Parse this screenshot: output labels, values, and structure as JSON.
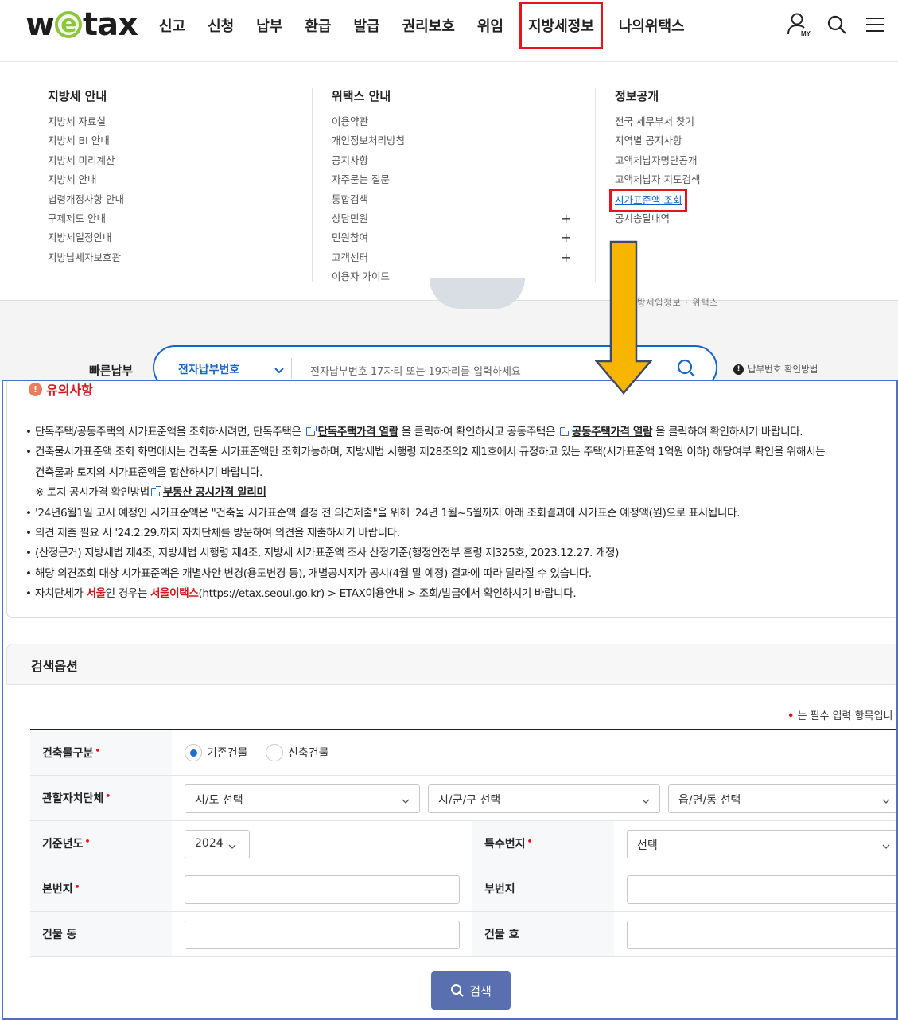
{
  "header": {
    "logo": {
      "pre": "w",
      "mid": "e",
      "post": "tax"
    },
    "nav": [
      "신고",
      "신청",
      "납부",
      "환급",
      "발급",
      "권리보호",
      "위임",
      "지방세정보",
      "나의위택스"
    ],
    "active_nav": "지방세정보",
    "icons": [
      "my-user-icon",
      "search-icon",
      "menu-icon"
    ],
    "my_badge": "MY"
  },
  "mega_menu": {
    "columns": [
      {
        "title": "지방세 안내",
        "items": [
          "지방세 자료실",
          "지방세 BI 안내",
          "지방세 미리계산",
          "지방세 안내",
          "법령개정사항 안내",
          "구제제도 안내",
          "지방세일정안내",
          "지방납세자보호관"
        ]
      },
      {
        "title": "위택스 안내",
        "items": [
          "이용약관",
          "개인정보처리방침",
          "공지사항",
          "자주묻는 질문",
          "통합검색",
          "상담민원",
          "민원참여",
          "고객센터",
          "이용자 가이드"
        ],
        "expandable": [
          5,
          6,
          7
        ],
        "plus": "+"
      },
      {
        "title": "정보공개",
        "items": [
          "전국 세무부서 찾기",
          "지역별 공지사항",
          "고액체납자명단공개",
          "고액체납자 지도검색",
          "시가표준액 조회",
          "공시송달내역"
        ],
        "highlighted": 4
      }
    ]
  },
  "quick_pay": {
    "label": "빠른납부",
    "select_value": "전자납부번호",
    "placeholder": "전자납부번호 17자리 또는 19자리를 입력하세요",
    "help_text": "납부번호 확인방법",
    "help_mark": "!"
  },
  "hero_fragment_text": "지방세입정보 · 위택스",
  "notice": {
    "title": "유의사항",
    "title_mark": "!",
    "items": [
      {
        "a": "단독주택/공동주택의 시가표준액을 조회하시려면, 단독주택은 ",
        "link1": "단독주택가격 열람",
        "b": " 을 클릭하여 확인하시고 공동주택은 ",
        "link2": "공동주택가격 열람",
        "c": " 을 클릭하여 확인하시기 바랍니다."
      },
      {
        "text": "건축물시가표준액 조회 화면에서는 건축물 시가표준액만 조회가능하며, 지방세법 시행령 제28조의2 제1호에서 규정하고 있는 주택(시가표준액 1억원 이하) 해당여부 확인을 위해서는"
      },
      {
        "text": "건축물과 토지의 시가표준액을 합산하시기 바랍니다."
      },
      {
        "prefix": "※  토지 공시가격 확인방법",
        "link": "부동산 공시가격 알리미"
      },
      {
        "text": "'24년6월1일 고시 예정인 시가표준액은 \"건축물 시가표준액 결정 전 의견제출\"을 위해 '24년 1월~5월까지 아래 조회결과에 시가표준 예정액(원)으로 표시됩니다."
      },
      {
        "text": "의견 제출 필요 시 '24.2.29.까지 자치단체를 방문하여 의견을 제출하시기 바랍니다."
      },
      {
        "text": "(산정근거) 지방세법 제4조, 지방세법 시행령 제4조, 지방세 시가표준액 조사 산정기준(행정안전부 훈령 제325호, 2023.12.27. 개정)"
      },
      {
        "text": "해당 의견조회 대상 시가표준액은 개별사안 변경(용도변경 등), 개별공시지가 공시(4월 말 예정) 결과에 따라 달라질 수 있습니다."
      },
      {
        "a": "자치단체가 ",
        "red1": "서울",
        "b": "인 경우는 ",
        "red2": "서울이택스",
        "c": "(https://etax.seoul.go.kr) > ETAX이용안내 > 조회/발급에서 확인하시기 바랍니다."
      }
    ]
  },
  "search": {
    "title": "검색옵션",
    "required_note": "는 필수 입력 항목입니",
    "required_mark": "•",
    "rows": {
      "building_type": {
        "label": "건축물구분",
        "options": [
          "기존건물",
          "신축건물"
        ],
        "selected": "기존건물"
      },
      "authority": {
        "label": "관할자치단체",
        "sido": "시/도 선택",
        "sigungu": "시/군/구 선택",
        "dong": "읍/면/동 선택"
      },
      "year": {
        "label": "기준년도",
        "value": "2024"
      },
      "special_lot": {
        "label": "특수번지",
        "value": "선택"
      },
      "main_lot": {
        "label": "본번지",
        "value": ""
      },
      "sub_lot": {
        "label": "부번지",
        "value": ""
      },
      "building_dong": {
        "label": "건물 동",
        "value": ""
      },
      "building_ho": {
        "label": "건물 호",
        "value": ""
      }
    },
    "button": "검색"
  },
  "colors": {
    "highlight": "#e8131e",
    "brand_green": "#8cc63f",
    "primary": "#1564c9",
    "button": "#5a6fb0",
    "arrow": "#f7b500"
  }
}
